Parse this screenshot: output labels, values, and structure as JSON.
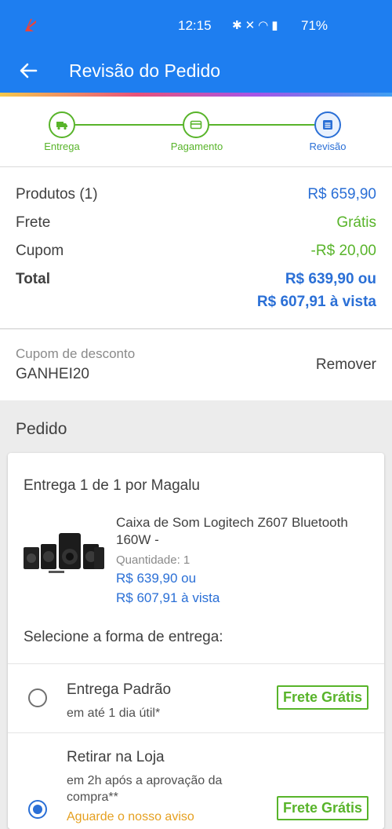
{
  "status_bar": {
    "time": "12:15",
    "battery": "71%",
    "icons": [
      "bluetooth-icon",
      "mute-icon",
      "wifi-icon",
      "signal-icon"
    ]
  },
  "app_bar": {
    "title": "Revisão do Pedido",
    "back_icon": "arrow-left-icon"
  },
  "stepper": {
    "steps": [
      {
        "label": "Entrega",
        "icon": "truck-icon",
        "state": "done"
      },
      {
        "label": "Pagamento",
        "icon": "card-icon",
        "state": "done"
      },
      {
        "label": "Revisão",
        "icon": "list-icon",
        "state": "active"
      }
    ]
  },
  "summary": {
    "rows": [
      {
        "label": "Produtos (1)",
        "value": "R$ 659,90"
      },
      {
        "label": "Frete",
        "value": "Grátis"
      },
      {
        "label": "Cupom",
        "value": "-R$ 20,00"
      }
    ],
    "total_label": "Total",
    "total_value": "R$ 639,90 ou",
    "total_vista": "R$ 607,91 à vista"
  },
  "coupon": {
    "label": "Cupom de desconto",
    "code": "GANHEI20",
    "remove_label": "Remover"
  },
  "order": {
    "section_title": "Pedido",
    "shipment_title": "Entrega 1 de 1 por Magalu",
    "product": {
      "name": "Caixa de Som Logitech Z607 Bluetooth 160W -",
      "quantity_label": "Quantidade:",
      "quantity": "1",
      "price": "R$ 639,90 ou",
      "price_vista": "R$ 607,91 à vista"
    },
    "delivery_title": "Selecione a forma de entrega:",
    "delivery_options": [
      {
        "title": "Entrega Padrão",
        "subtitle": "em até 1 dia útil*",
        "badge": "Frete Grátis",
        "selected": false
      },
      {
        "title": "Retirar na Loja",
        "subtitle_line1": "em 2h após a aprovação da",
        "subtitle_line2": "compra**",
        "warning": "Aguarde o nosso aviso",
        "badge": "Frete Grátis",
        "selected": true
      }
    ]
  },
  "colors": {
    "primary": "#1e7ef0",
    "link_blue": "#2a6fd6",
    "success_green": "#58b42a",
    "warning_orange": "#e5a020"
  }
}
